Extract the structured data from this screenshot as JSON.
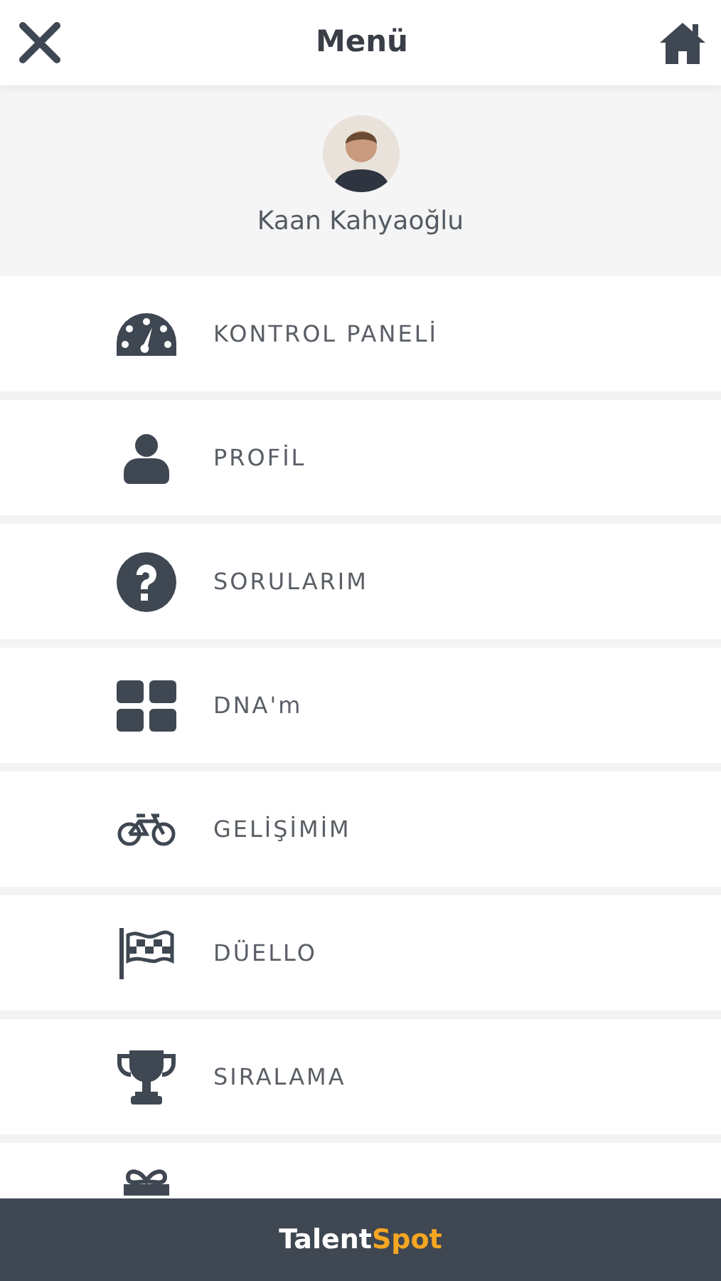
{
  "header": {
    "title": "Menü"
  },
  "profile": {
    "name": "Kaan Kahyaoğlu"
  },
  "menu_items": [
    {
      "kind": "full",
      "label": "KONTROL PANELİ"
    },
    {
      "kind": "full",
      "label": "PROFİL"
    },
    {
      "kind": "full",
      "label": "SORULARIM"
    },
    {
      "kind": "full",
      "label": "DNA'm"
    },
    {
      "kind": "full",
      "label": "GELİŞİMİM"
    },
    {
      "kind": "full",
      "label": "DÜELLO"
    },
    {
      "kind": "full",
      "label": "SIRALAMA"
    },
    {
      "kind": "covered"
    }
  ],
  "footer": {
    "brand": [
      "Talent",
      "Spot"
    ]
  }
}
